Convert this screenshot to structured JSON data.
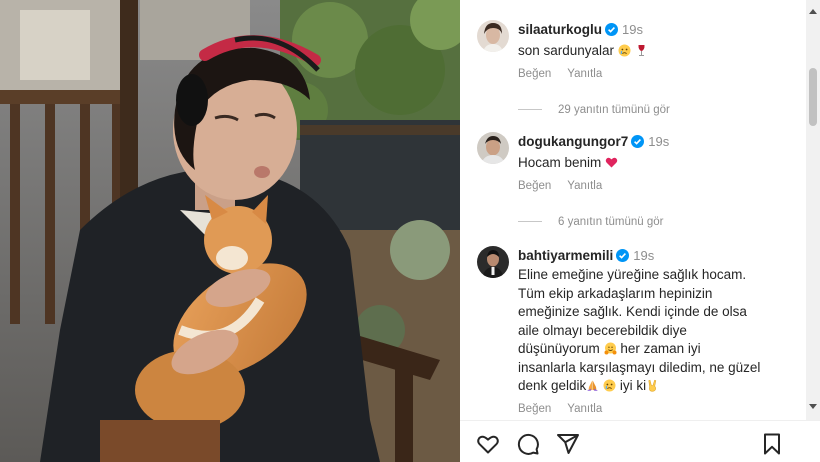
{
  "comments": [
    {
      "username": "silaaturkoglu",
      "time": "19s",
      "text": "son sardunyalar",
      "emojis": [
        "crying-face",
        "wine-glass"
      ],
      "like_label": "Beğen",
      "reply_label": "Yanıtla",
      "replies_label": "29 yanıtın tümünü gör"
    },
    {
      "username": "dogukangungor7",
      "time": "19s",
      "text": "Hocam benim",
      "emojis": [
        "heart"
      ],
      "like_label": "Beğen",
      "reply_label": "Yanıtla",
      "replies_label": "6 yanıtın tümünü gör"
    },
    {
      "username": "bahtiyarmemili",
      "time": "19s",
      "lines": [
        "Eline emeğine yüreğine sağlık hocam.",
        "Tüm ekip arkadaşlarım hepinizin",
        "emeğinize sağlık. Kendi içinde de olsa",
        "aile olmayı becerebildik diye",
        "düşünüyorum",
        " her zaman iyi",
        "insanlarla karşılaşmayı diledim, ne güzel",
        "denk geldik",
        " iyi ki"
      ],
      "emojis": [
        "hugging-face",
        "folded-hands",
        "crying-face",
        "victory-hand"
      ],
      "like_label": "Beğen",
      "reply_label": "Yanıtla"
    }
  ],
  "icons": {
    "verified": "verified-badge-icon",
    "bar": [
      "heart-icon",
      "comment-icon",
      "share-icon",
      "bookmark-icon"
    ]
  },
  "colors": {
    "verified": "#0095f6",
    "text": "#262626",
    "muted": "#8e8e8e",
    "heart_emoji": "#e0245e"
  }
}
